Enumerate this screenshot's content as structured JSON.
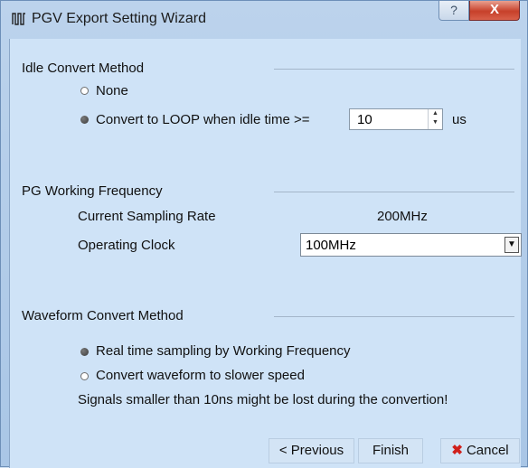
{
  "window": {
    "title": "PGV Export Setting Wizard",
    "help_label": "?",
    "close_label": "X"
  },
  "idle_section": {
    "title": "Idle Convert Method",
    "options": [
      {
        "label": "None",
        "selected": false
      },
      {
        "label": "Convert to LOOP when idle time >=",
        "selected": true
      }
    ],
    "idle_time_value": "10",
    "idle_time_unit": "us"
  },
  "frequency_section": {
    "title": "PG Working Frequency",
    "sampling_rate_label": "Current Sampling Rate",
    "sampling_rate_value": "200MHz",
    "operating_clock_label": "Operating Clock",
    "operating_clock_value": "100MHz"
  },
  "waveform_section": {
    "title": "Waveform Convert Method",
    "options": [
      {
        "label": "Real time sampling by Working Frequency",
        "selected": true
      },
      {
        "label": "Convert waveform to slower speed",
        "selected": false
      }
    ],
    "warning": "Signals smaller than 10ns might be lost during the convertion!"
  },
  "buttons": {
    "previous": "< Previous",
    "finish": "Finish",
    "cancel": "Cancel"
  },
  "colors": {
    "client_background": "#cfe3f7",
    "close_button": "#c7402a",
    "cancel_icon": "#d0201b"
  },
  "icons": {
    "app": "pulse-waveform-icon",
    "cancel": "red-x-icon"
  }
}
